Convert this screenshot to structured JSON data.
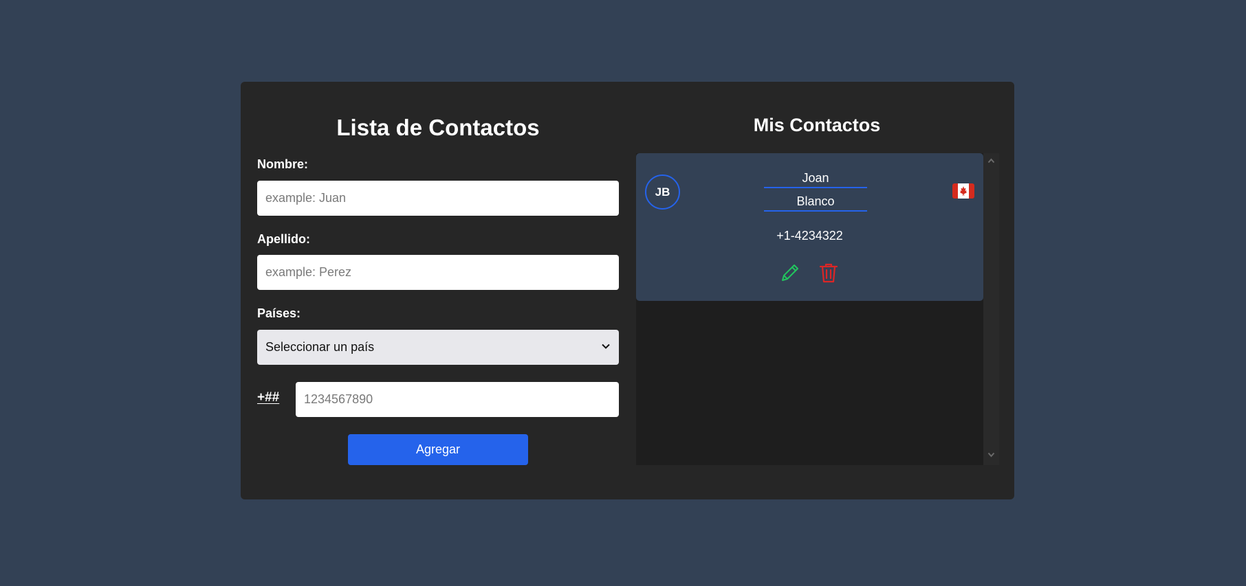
{
  "form": {
    "title": "Lista de Contactos",
    "first_name_label": "Nombre:",
    "first_name_placeholder": "example: Juan",
    "last_name_label": "Apellido:",
    "last_name_placeholder": "example: Perez",
    "country_label": "Países:",
    "country_selected": "Seleccionar un país",
    "phone_prefix": "+##",
    "phone_placeholder": "1234567890",
    "add_button": "Agregar"
  },
  "contacts": {
    "title": "Mis Contactos",
    "items": [
      {
        "initials": "JB",
        "first_name": "Joan",
        "last_name": "Blanco",
        "phone": "+1-4234322",
        "flag_icon": "canada-flag-icon"
      }
    ]
  },
  "colors": {
    "background": "#334155",
    "card": "#262626",
    "accent": "#2563eb",
    "edit": "#22c55e",
    "delete": "#dc2626"
  }
}
